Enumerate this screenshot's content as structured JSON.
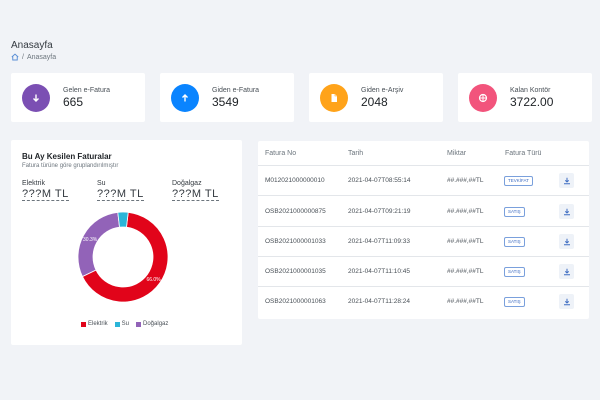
{
  "page": {
    "title": "Anasayfa"
  },
  "breadcrumb": {
    "separator": "/",
    "current": "Anasayfa"
  },
  "stats": [
    {
      "label": "Gelen e-Fatura",
      "value": "665",
      "icon": "arrow-down-icon",
      "color": "#7b4fb3"
    },
    {
      "label": "Giden e-Fatura",
      "value": "3549",
      "icon": "arrow-up-icon",
      "color": "#0a84ff"
    },
    {
      "label": "Giden e-Arşiv",
      "value": "2048",
      "icon": "document-icon",
      "color": "#ffa31a"
    },
    {
      "label": "Kalan Kontör",
      "value": "3722.00",
      "icon": "target-icon",
      "color": "#f2547c"
    }
  ],
  "chart_card": {
    "title": "Bu Ay Kesilen Faturalar",
    "subtitle": "Fatura türüne göre gruplandırılmıştır",
    "categories": [
      {
        "label": "Elektrik",
        "value": "???M TL"
      },
      {
        "label": "Su",
        "value": "???M TL"
      },
      {
        "label": "Doğalgaz",
        "value": "???M TL"
      }
    ]
  },
  "chart_data": {
    "type": "pie",
    "categories": [
      "Elektrik",
      "Su",
      "Doğalgaz"
    ],
    "values": [
      66.0,
      3.7,
      30.3
    ],
    "data_labels": [
      "66.0%",
      "",
      "30.3%"
    ],
    "colors": [
      "#e1041a",
      "#2bb5d8",
      "#9263b8"
    ],
    "legend_placement": "bottom"
  },
  "table": {
    "headers": [
      "Fatura No",
      "Tarih",
      "Miktar",
      "Fatura Türü"
    ],
    "rows": [
      {
        "no": "M012021000000010",
        "date": "2021-04-07T08:55:14",
        "amount": "##.###,##TL",
        "type": "TEVKİFAT"
      },
      {
        "no": "OSB2021000000875",
        "date": "2021-04-07T09:21:19",
        "amount": "##.###,##TL",
        "type": "SATIŞ"
      },
      {
        "no": "OSB2021000001033",
        "date": "2021-04-07T11:09:33",
        "amount": "##.###,##TL",
        "type": "SATIŞ"
      },
      {
        "no": "OSB2021000001035",
        "date": "2021-04-07T11:10:45",
        "amount": "##.###,##TL",
        "type": "SATIŞ"
      },
      {
        "no": "OSB2021000001063",
        "date": "2021-04-07T11:28:24",
        "amount": "##.###,##TL",
        "type": "SATIŞ"
      }
    ]
  }
}
